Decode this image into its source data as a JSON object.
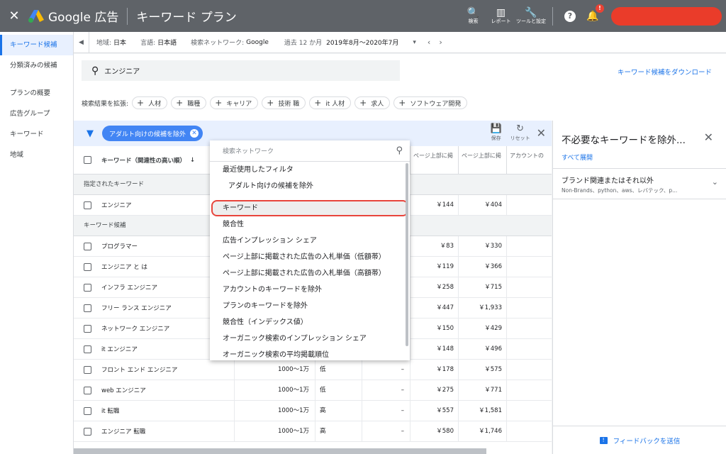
{
  "header": {
    "close": "✕",
    "brand": "Google 広告",
    "title": "キーワード プラン",
    "tools": [
      {
        "icon": "search-icon",
        "glyph": "🔍",
        "label": "検索"
      },
      {
        "icon": "report-icon",
        "glyph": "▥",
        "label": "レポート"
      },
      {
        "icon": "wrench-icon",
        "glyph": "🔧",
        "label": "ツールと設定"
      }
    ],
    "help": "?",
    "notif_badge": "!"
  },
  "sidenav": {
    "active": "キーワード候補",
    "items": [
      "分類済みの候補",
      "プランの概要",
      "広告グループ",
      "キーワード",
      "地域"
    ]
  },
  "filterbar": {
    "location_label": "地域:",
    "location_value": "日本",
    "language_label": "言語:",
    "language_value": "日本語",
    "network_label": "検索ネットワーク:",
    "network_value": "Google",
    "period_label": "過去 12 か月",
    "period_value": "2019年8月～2020年7月"
  },
  "search": {
    "query": "エンジニア",
    "download": "キーワード候補をダウンロード",
    "expand_label": "検索結果を拡張:",
    "chips": [
      "人材",
      "職種",
      "キャリア",
      "技術 職",
      "it 人材",
      "求人",
      "ソフトウェア開発"
    ]
  },
  "table": {
    "filter_pill": "アダルト向けの候補を除外",
    "save": "保存",
    "reset": "リセット",
    "col_keyword": "キーワード（関連性の高い順）",
    "col_low": "ページ上部に掲",
    "col_high": "ページ上部に掲",
    "col_account": "アカウントの",
    "section_specified": "指定されたキーワード",
    "section_ideas": "キーワード候補",
    "specified_rows": [
      {
        "kw": "エンジニア",
        "vol": "",
        "comp": "",
        "share": "",
        "low": "￥144",
        "high": "￥404"
      }
    ],
    "idea_rows": [
      {
        "kw": "プログラマー",
        "vol": "",
        "comp": "",
        "share": "",
        "low": "￥83",
        "high": "￥330"
      },
      {
        "kw": "エンジニア と は",
        "vol": "",
        "comp": "",
        "share": "",
        "low": "￥119",
        "high": "￥366"
      },
      {
        "kw": "インフラ エンジニア",
        "vol": "",
        "comp": "",
        "share": "",
        "low": "￥258",
        "high": "￥715"
      },
      {
        "kw": "フリー ランス エンジニア",
        "vol": "",
        "comp": "",
        "share": "",
        "low": "￥447",
        "high": "￥1,933"
      },
      {
        "kw": "ネットワーク エンジニア",
        "vol": "",
        "comp": "",
        "share": "",
        "low": "￥150",
        "high": "￥429"
      },
      {
        "kw": "it エンジニア",
        "vol": "",
        "comp": "",
        "share": "",
        "low": "￥148",
        "high": "￥496"
      },
      {
        "kw": "フロント エンド エンジニア",
        "vol": "1000～1万",
        "comp": "低",
        "share": "–",
        "low": "￥178",
        "high": "￥575"
      },
      {
        "kw": "web エンジニア",
        "vol": "1000～1万",
        "comp": "低",
        "share": "–",
        "low": "￥275",
        "high": "￥771"
      },
      {
        "kw": "it 転職",
        "vol": "1000～1万",
        "comp": "高",
        "share": "–",
        "low": "￥557",
        "high": "￥1,581"
      },
      {
        "kw": "エンジニア 転職",
        "vol": "1000～1万",
        "comp": "高",
        "share": "–",
        "low": "￥580",
        "high": "￥1,746"
      }
    ]
  },
  "dropdown": {
    "placeholder": "検索ネットワーク",
    "recent_header": "最近使用したフィルタ",
    "recent_item": "アダルト向けの候補を除外",
    "items": [
      {
        "label": "キーワード",
        "highlighted": true
      },
      {
        "label": "競合性",
        "highlighted": false
      },
      {
        "label": "広告インプレッション シェア",
        "highlighted": false
      },
      {
        "label": "ページ上部に掲載された広告の入札単価（低額帯）",
        "highlighted": false
      },
      {
        "label": "ページ上部に掲載された広告の入札単価（高額帯）",
        "highlighted": false
      },
      {
        "label": "アカウントのキーワードを除外",
        "highlighted": false
      },
      {
        "label": "プランのキーワードを除外",
        "highlighted": false
      },
      {
        "label": "競合性（インデックス値）",
        "highlighted": false
      },
      {
        "label": "オーガニック検索のインプレッション シェア",
        "highlighted": false
      },
      {
        "label": "オーガニック検索の平均掲載順位",
        "highlighted": false
      }
    ]
  },
  "rightpanel": {
    "title": "不必要なキーワードを除外...",
    "expand_all": "すべて展開",
    "item_title": "ブランド関連またはそれ以外",
    "item_sub": "Non-Brands、python、aws、レバテック、p...",
    "feedback": "フィードバックを送信"
  },
  "colors": {
    "accent": "#1a73e8",
    "highlight_border": "#e8453c",
    "topbar": "#5f6368"
  }
}
